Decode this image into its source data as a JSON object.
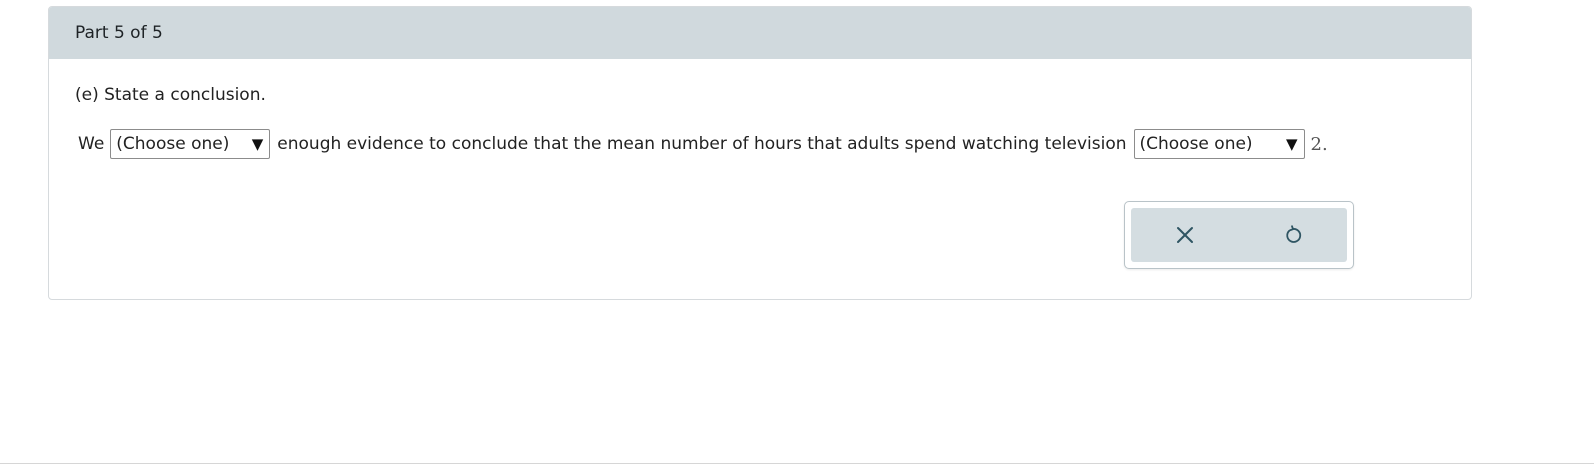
{
  "header": {
    "part_label": "Part 5 of 5"
  },
  "question": {
    "prompt": "(e) State a conclusion."
  },
  "sentence": {
    "word_we": "We",
    "select_1": {
      "selected": "(Choose one)",
      "arrow": "▼"
    },
    "middle_text": "enough evidence to conclude that the mean number of hours that adults spend watching television",
    "select_2": {
      "selected": "(Choose one)",
      "arrow": "▼"
    },
    "tail_text": "2."
  },
  "actions": {
    "clear_icon": "close-icon",
    "reset_icon": "undo-icon"
  },
  "colors": {
    "header_bg": "#d0d9dd",
    "action_bg": "#d4dde1",
    "icon_color": "#2f5563"
  }
}
